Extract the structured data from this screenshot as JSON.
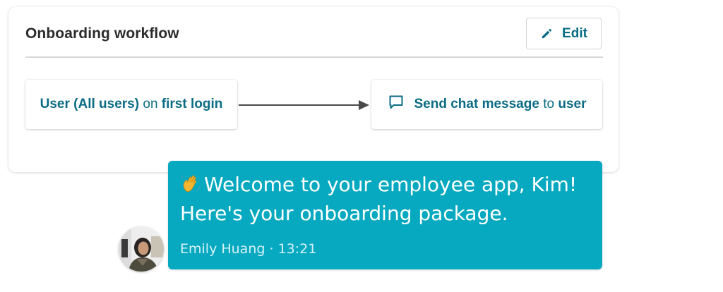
{
  "workflow": {
    "title": "Onboarding workflow",
    "edit_label": "Edit",
    "trigger": {
      "subject": "User (All users)",
      "connector": "on",
      "event": "first login"
    },
    "action": {
      "icon": "chat-message-icon",
      "verb": "Send chat message",
      "connector": "to",
      "target": "user"
    }
  },
  "message": {
    "emoji": "waving-hand",
    "line1": "Welcome to your employee app, Kim!",
    "line2": "Here's your onboarding package.",
    "sender": "Emily Huang",
    "separator": "·",
    "time": "13:21"
  },
  "colors": {
    "accent": "#0a6c84",
    "bubble": "#06a9c0",
    "title_text": "#2b2b2b",
    "divider": "#d8d8d8"
  }
}
